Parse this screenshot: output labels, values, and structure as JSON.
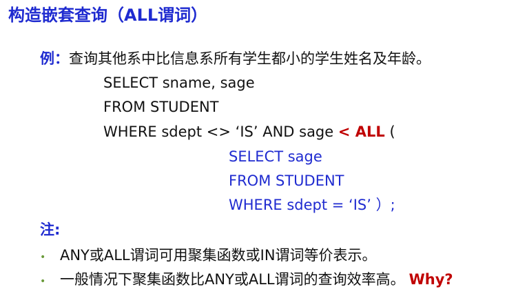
{
  "title": "构造嵌套查询（ALL谓词）",
  "example": {
    "label": "例：",
    "text": "查询其他系中比信息系所有学生都小的学生姓名及年龄。"
  },
  "outer_query": {
    "select": "SELECT sname, sage",
    "from": "FROM STUDENT",
    "where_prefix": "WHERE  sdept <>  ‘IS’   AND sage ",
    "where_keyword": "< ALL",
    "where_paren": " ("
  },
  "inner_query": {
    "select": "SELECT  sage",
    "from": "FROM  STUDENT",
    "where": "WHERE  sdept =  ‘IS’ ）;"
  },
  "note": {
    "label": "注:",
    "bullets": [
      {
        "text": "ANY或ALL谓词可用聚集函数或IN谓词等价表示。",
        "emphasis": ""
      },
      {
        "text": "一般情况下聚集函数比ANY或ALL谓词的查询效率高。",
        "emphasis": "Why?"
      }
    ]
  },
  "colors": {
    "blue": "#1f2bd0",
    "red": "#c00000",
    "bullet": "#6a9a3a"
  }
}
